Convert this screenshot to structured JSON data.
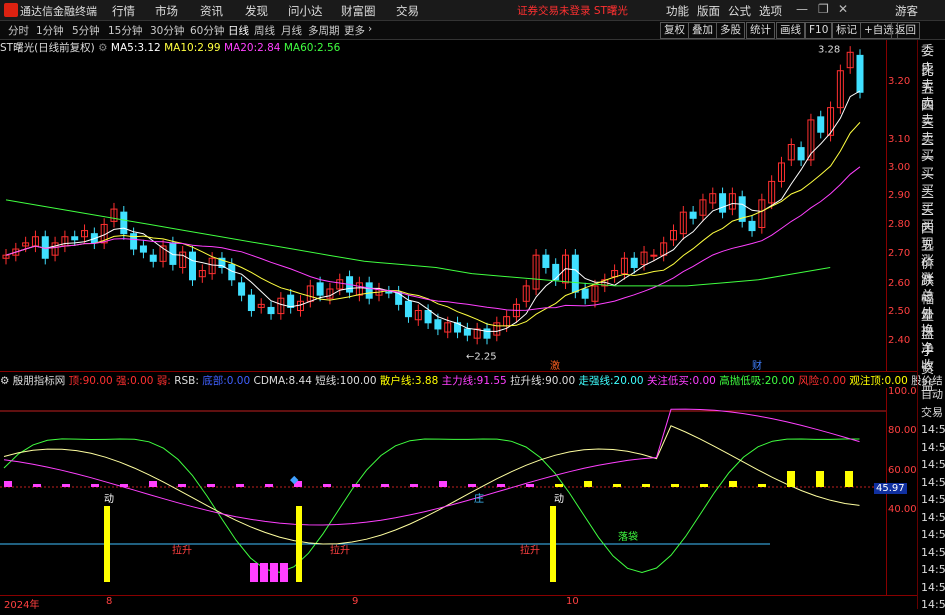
{
  "app": {
    "title": "通达信金融终端",
    "warning": "证券交易未登录 ST曙光"
  },
  "menu": [
    "行情",
    "市场",
    "资讯",
    "发现",
    "问小达",
    "财富圈",
    "交易"
  ],
  "menu_right": [
    "功能",
    "版面",
    "公式",
    "选项",
    "游客"
  ],
  "toolbar": {
    "periods": [
      "分时",
      "1分钟",
      "5分钟",
      "15分钟",
      "30分钟",
      "60分钟",
      "日线",
      "周线",
      "月线",
      "多周期",
      "更多"
    ],
    "active": "日线",
    "right": [
      "复权",
      "叠加",
      "多股",
      "统计",
      "画线",
      "F10",
      "标记",
      "+自选",
      "返回"
    ]
  },
  "main_info": {
    "stock": "ST曙光(日线前复权)",
    "ma5_label": "MA5:",
    "ma5": "3.12",
    "ma10_label": "MA10:",
    "ma10": "2.99",
    "ma20_label": "MA20:",
    "ma20": "2.84",
    "ma60_label": "MA60:",
    "ma60": "2.56"
  },
  "price_axis": [
    "3.20",
    "3.10",
    "3.00",
    "2.90",
    "2.80",
    "2.70",
    "2.60",
    "2.50",
    "2.40"
  ],
  "annotations": {
    "high": "3.28",
    "low": "2.25",
    "mark1": "激",
    "mark2": "财"
  },
  "indicator_info": {
    "name": "殷朋指标网",
    "items": [
      {
        "label": "顶:",
        "value": "90.00",
        "color": "#ff3030"
      },
      {
        "label": "强:",
        "value": "0.00",
        "color": "#ff3030"
      },
      {
        "label": "弱:",
        "value": "",
        "color": "#ff3030"
      },
      {
        "label": "RSB:",
        "value": "",
        "color": "#ddd"
      },
      {
        "label": "底部:",
        "value": "0.00",
        "color": "#4060ff"
      },
      {
        "label": "CDMA:",
        "value": "8.44",
        "color": "#ddd"
      },
      {
        "label": "短线:",
        "value": "100.00",
        "color": "#ddd"
      },
      {
        "label": "散户线:",
        "value": "3.88",
        "color": "#ffff00"
      },
      {
        "label": "主力线:",
        "value": "91.55",
        "color": "#ff40ff"
      },
      {
        "label": "拉升线:",
        "value": "90.00",
        "color": "#ddd"
      },
      {
        "label": "走强线:",
        "value": "20.00",
        "color": "#40ffff"
      },
      {
        "label": "关注低买:",
        "value": "0.00",
        "color": "#ff40ff"
      },
      {
        "label": "高抛低吸:",
        "value": "20.00",
        "color": "#40ff40"
      },
      {
        "label": "风险:",
        "value": "0.00",
        "color": "#ff3030"
      },
      {
        "label": "观注顶:",
        "value": "0.00",
        "color": "#ffff00"
      },
      {
        "label": "股价结",
        "value": "",
        "color": "#ddd"
      }
    ]
  },
  "ind_axis": [
    "100.0",
    "80.00",
    "60.00",
    "40.00"
  ],
  "ind_labels": {
    "dong1": "动",
    "lasheng1": "拉升",
    "lasheng2": "拉升",
    "zhuang": "庄",
    "dong2": "动",
    "lasheng3": "拉升",
    "luodi": "落袋",
    "current": "45.97"
  },
  "side_panel": [
    "委比",
    "卖五",
    "卖四",
    "卖三",
    "卖二",
    "卖一",
    "买一",
    "买二",
    "买三",
    "买四",
    "买五",
    "现价",
    "涨跌",
    "涨幅",
    "总量",
    "外盘",
    "换手",
    "净资",
    "收益"
  ],
  "ind_side": [
    "自动",
    "交易",
    "14:56",
    "14:56",
    "14:56",
    "14:56",
    "14:56",
    "14:56",
    "14:56",
    "14:56",
    "14:56",
    "14:56",
    "14:56"
  ],
  "x_axis": [
    "2024年",
    "8",
    "9",
    "10"
  ],
  "colors": {
    "up": "#ff3030",
    "down": "#40e0ff",
    "ma5": "#ffffff",
    "ma10": "#ffff40",
    "ma20": "#ff40ff",
    "ma60": "#40ff40"
  }
}
